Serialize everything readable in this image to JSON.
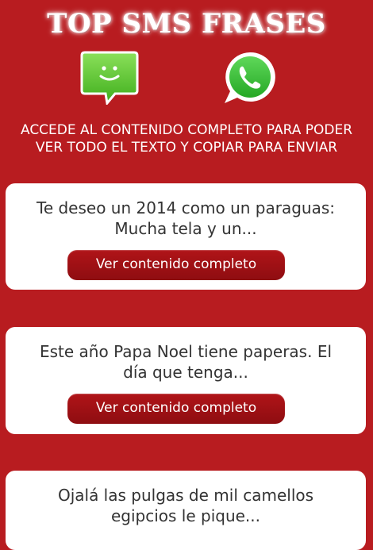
{
  "header": {
    "title": "TOP SMS FRASES",
    "sms_icon": "sms-message-icon",
    "whatsapp_icon": "whatsapp-icon",
    "instructions_line1": "ACCEDE AL CONTENIDO COMPLETO PARA PODER",
    "instructions_line2": "VER TODO EL TEXTO Y COPIAR PARA ENVIAR"
  },
  "colors": {
    "background": "#b81c20",
    "button": "#9c1014",
    "card": "#ffffff",
    "sms_green": "#5cc92e",
    "whatsapp_green": "#3bbd3b"
  },
  "cards": [
    {
      "line1": "Te deseo un 2014 como un paraguas:",
      "line2": "Mucha tela y un...",
      "button_label": "Ver contenido completo"
    },
    {
      "line1": "Este año Papa Noel tiene paperas. El",
      "line2": "día que tenga...",
      "button_label": "Ver contenido completo"
    },
    {
      "line1": "Ojalá las pulgas de mil camellos",
      "line2": "egipcios le pique..."
    }
  ]
}
